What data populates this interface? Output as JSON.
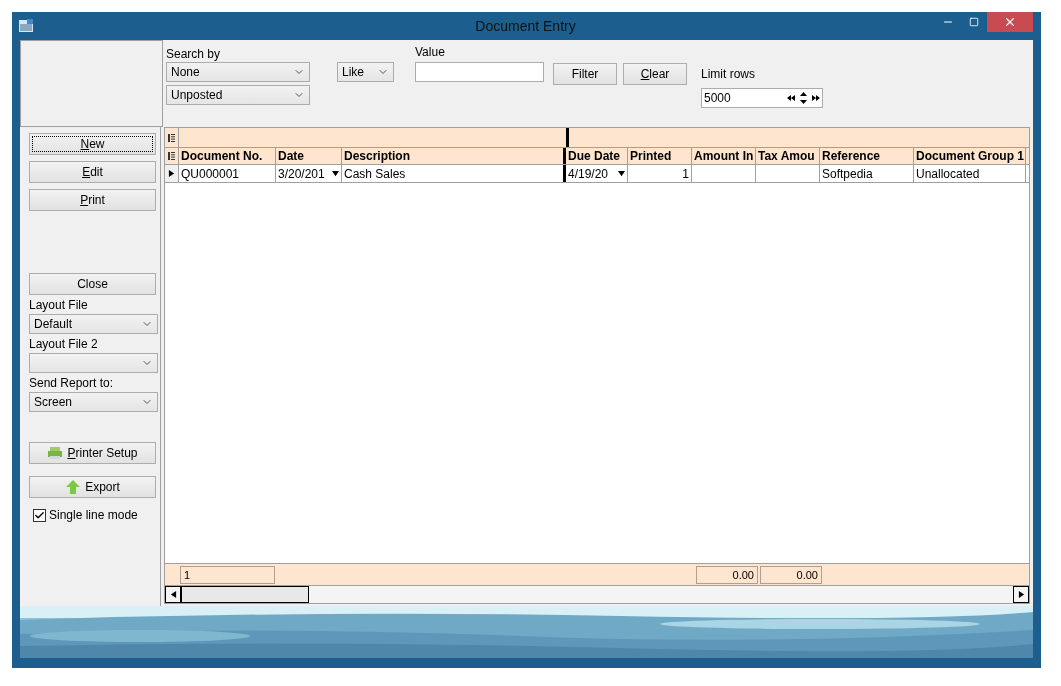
{
  "window": {
    "title": "Document Entry"
  },
  "filter": {
    "search_by_label": "Search by",
    "search_by": "None",
    "status": "Unposted",
    "operator": "Like",
    "value_label": "Value",
    "buttons": [
      {
        "label": "Filter",
        "accelerator": false
      },
      {
        "label": "Clear",
        "accelerator": true
      }
    ],
    "limit_rows_label": "Limit rows",
    "limit_rows": "5000"
  },
  "sidebar": {
    "top_buttons": [
      {
        "label": "New",
        "accelerator": true,
        "focused": true
      },
      {
        "label": "Edit",
        "accelerator": true,
        "focused": false
      },
      {
        "label": "Print",
        "accelerator": true,
        "focused": false
      }
    ],
    "close_button": {
      "label": "Close",
      "accelerator": false
    },
    "selects": [
      {
        "label": "Layout File",
        "value": "Default"
      },
      {
        "label": "Layout File 2"
      },
      {
        "label": "Send Report to:",
        "value": "Screen"
      }
    ],
    "action_buttons": [
      {
        "label": "Printer Setup",
        "accelerator": true,
        "kind": "printer"
      },
      {
        "label": "Export",
        "accelerator": false,
        "kind": "export"
      }
    ],
    "single_line_mode": {
      "label": "Single line mode",
      "checked": true
    }
  },
  "grid": {
    "columns": [
      {
        "label": "Document No.",
        "kind": "text",
        "frozen": false
      },
      {
        "label": "Date",
        "kind": "date",
        "frozen": false
      },
      {
        "label": "Description",
        "kind": "text",
        "frozen": true
      },
      {
        "label": "Due Date",
        "kind": "date",
        "frozen": false
      },
      {
        "label": "Printed",
        "kind": "number",
        "frozen": false
      },
      {
        "label": "Amount In",
        "kind": "number",
        "frozen": false
      },
      {
        "label": "Tax Amou",
        "kind": "number",
        "frozen": false
      },
      {
        "label": "Reference",
        "kind": "text",
        "frozen": false
      },
      {
        "label": "Document Group 1",
        "kind": "text",
        "frozen": false
      }
    ],
    "rows": [
      {
        "selected": true,
        "cells": [
          "QU000001",
          "3/20/201",
          "Cash Sales",
          "4/19/20",
          "1",
          null,
          null,
          "Softpedia",
          "Unallocated"
        ]
      }
    ],
    "footer": {
      "count": "1",
      "totals": [
        "0.00",
        "0.00"
      ]
    }
  }
}
